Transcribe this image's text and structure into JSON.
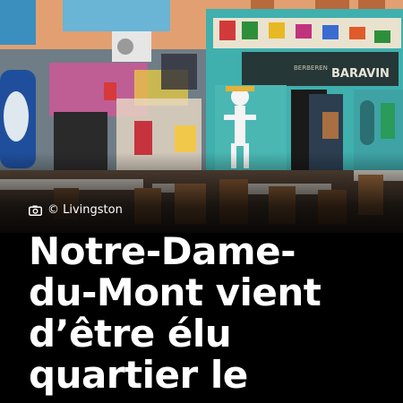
{
  "photo": {
    "credit_text": "© Livingston",
    "camera_icon": "camera-icon",
    "storefront_sign": "BARAVIN",
    "storefront_banner": "BERBEREN"
  },
  "headline": {
    "lines": [
      "Notre-Dame-",
      "du-Mont vient",
      "d’être élu",
      "quartier le"
    ]
  },
  "colors": {
    "background": "#000000",
    "text": "#ffffff"
  }
}
